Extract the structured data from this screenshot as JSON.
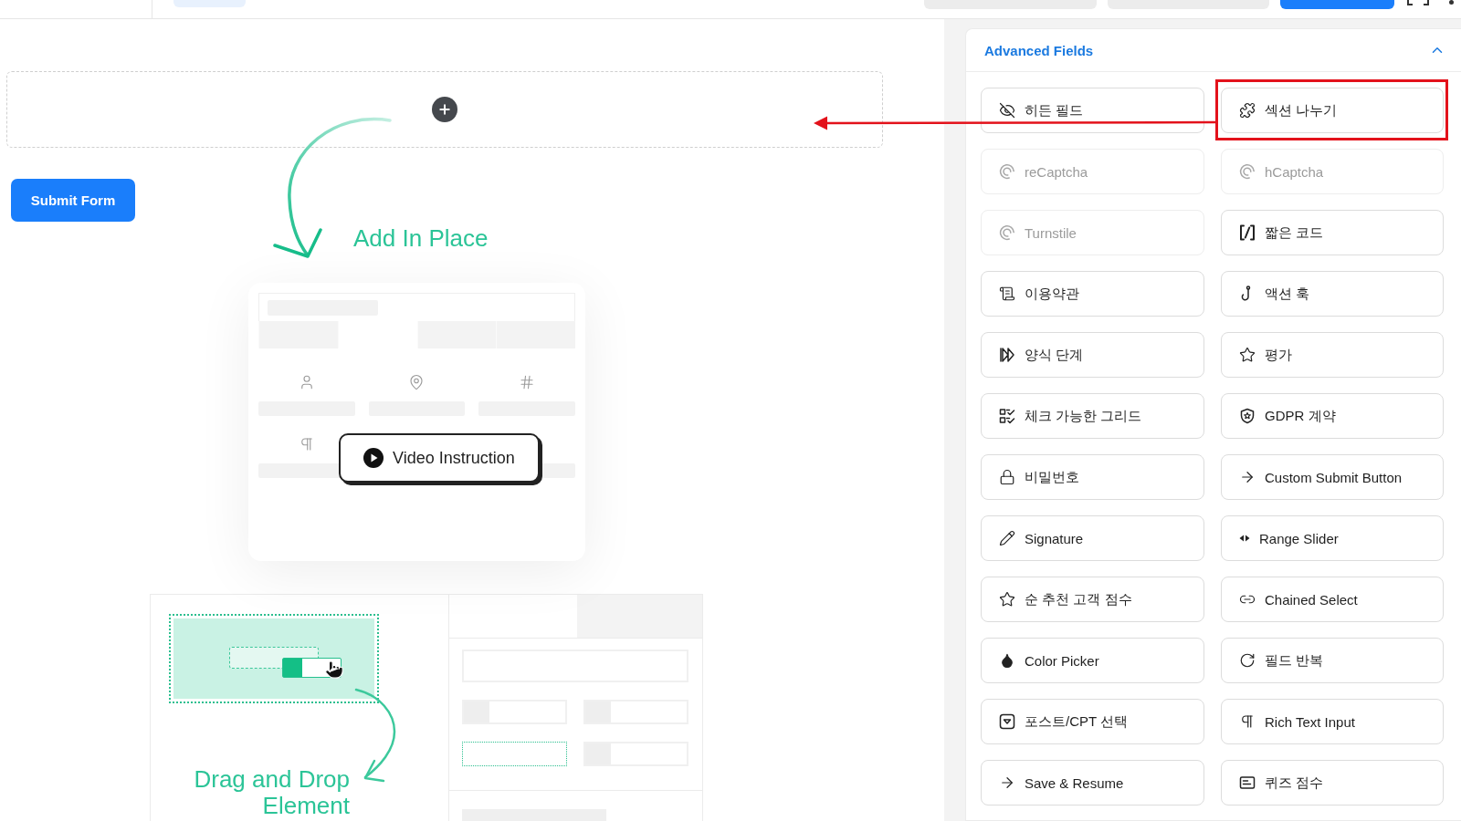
{
  "canvas": {
    "submit_button": "Submit Form",
    "guide": {
      "add_caption": "Add In Place",
      "video_button": "Video Instruction",
      "drag_caption": "Drag and Drop Element"
    }
  },
  "sidebar": {
    "section": {
      "title": "Advanced Fields",
      "expanded": true,
      "fields": [
        {
          "label": "히든 필드",
          "disabled": false,
          "highlighted": false
        },
        {
          "label": "섹션 나누기",
          "disabled": false,
          "highlighted": true
        },
        {
          "label": "reCaptcha",
          "disabled": true,
          "highlighted": false
        },
        {
          "label": "hCaptcha",
          "disabled": true,
          "highlighted": false
        },
        {
          "label": "Turnstile",
          "disabled": true,
          "highlighted": false
        },
        {
          "label": "짧은 코드",
          "disabled": false,
          "highlighted": false
        },
        {
          "label": "이용약관",
          "disabled": false,
          "highlighted": false
        },
        {
          "label": "액션 훅",
          "disabled": false,
          "highlighted": false
        },
        {
          "label": "양식 단계",
          "disabled": false,
          "highlighted": false
        },
        {
          "label": "평가",
          "disabled": false,
          "highlighted": false
        },
        {
          "label": "체크 가능한 그리드",
          "disabled": false,
          "highlighted": false
        },
        {
          "label": "GDPR 계약",
          "disabled": false,
          "highlighted": false
        },
        {
          "label": "비밀번호",
          "disabled": false,
          "highlighted": false
        },
        {
          "label": "Custom Submit Button",
          "disabled": false,
          "highlighted": false
        },
        {
          "label": "Signature",
          "disabled": false,
          "highlighted": false
        },
        {
          "label": "Range Slider",
          "disabled": false,
          "highlighted": false
        },
        {
          "label": "순 추천 고객 점수",
          "disabled": false,
          "highlighted": false
        },
        {
          "label": "Chained Select",
          "disabled": false,
          "highlighted": false
        },
        {
          "label": "Color Picker",
          "disabled": false,
          "highlighted": false
        },
        {
          "label": "필드 반복",
          "disabled": false,
          "highlighted": false
        },
        {
          "label": "포스트/CPT 선택",
          "disabled": false,
          "highlighted": false
        },
        {
          "label": "Rich Text Input",
          "disabled": false,
          "highlighted": false
        },
        {
          "label": "Save & Resume",
          "disabled": false,
          "highlighted": false
        },
        {
          "label": "퀴즈 점수",
          "disabled": false,
          "highlighted": false
        }
      ]
    }
  }
}
